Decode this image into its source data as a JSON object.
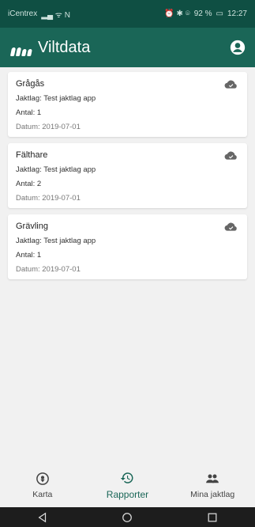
{
  "status_bar": {
    "carrier": "iCentrex",
    "signal_icons": "▂▄ ᯤ N",
    "right_icons": "⏰ ✱ ⌾",
    "battery": "92 %",
    "time": "12:27"
  },
  "app_bar": {
    "title": "Viltdata",
    "logo_icon": "hoofprint-icon",
    "profile_icon": "account-circle-icon"
  },
  "reports": [
    {
      "species": "Grågås",
      "jaktlag": "Jaktlag: Test jaktlag app",
      "antal": "Antal: 1",
      "datum": "Datum: 2019-07-01",
      "status_icon": "cloud-done-icon"
    },
    {
      "species": "Fälthare",
      "jaktlag": "Jaktlag: Test jaktlag app",
      "antal": "Antal: 2",
      "datum": "Datum: 2019-07-01",
      "status_icon": "cloud-done-icon"
    },
    {
      "species": "Grävling",
      "jaktlag": "Jaktlag: Test jaktlag app",
      "antal": "Antal: 1",
      "datum": "Datum: 2019-07-01",
      "status_icon": "cloud-done-icon"
    }
  ],
  "bottom_nav": {
    "items": [
      {
        "label": "Karta",
        "icon": "map-pin-icon",
        "active": false
      },
      {
        "label": "Rapporter",
        "icon": "history-icon",
        "active": true
      },
      {
        "label": "Mina jaktlag",
        "icon": "people-icon",
        "active": false
      }
    ]
  },
  "colors": {
    "primary": "#1a6657",
    "status_bar": "#0f4f43",
    "background": "#f1f1f1",
    "card": "#ffffff"
  }
}
